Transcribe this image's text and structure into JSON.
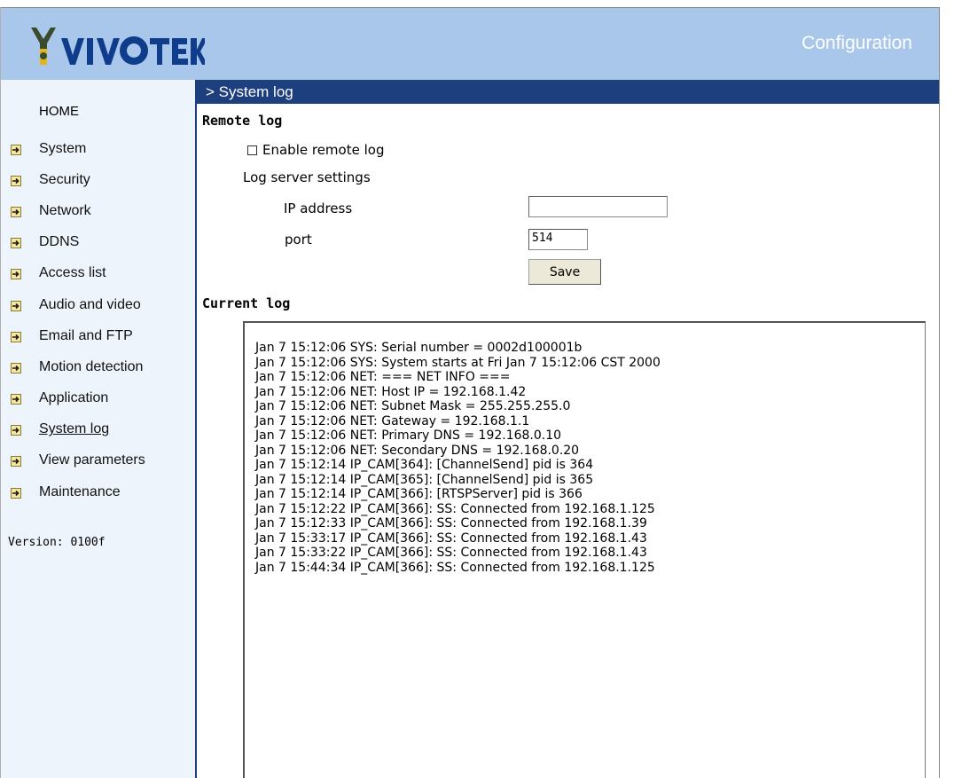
{
  "header": {
    "logo_text": "VIVOTEK",
    "title": "Configuration",
    "background": "#a9c7ea"
  },
  "sidebar": {
    "home_label": "HOME",
    "items": [
      {
        "label": "System",
        "icon": "arrow-right-icon"
      },
      {
        "label": "Security",
        "icon": "arrow-right-icon"
      },
      {
        "label": "Network",
        "icon": "arrow-right-icon"
      },
      {
        "label": "DDNS",
        "icon": "arrow-right-icon"
      },
      {
        "label": "Access list",
        "icon": "arrow-right-icon"
      },
      {
        "label": "Audio and video",
        "icon": "arrow-right-icon"
      },
      {
        "label": "Email and FTP",
        "icon": "arrow-right-icon"
      },
      {
        "label": "Motion detection",
        "icon": "arrow-right-icon"
      },
      {
        "label": "Application",
        "icon": "arrow-right-icon"
      },
      {
        "label": "System log",
        "icon": "arrow-right-icon",
        "active": true
      },
      {
        "label": "View parameters",
        "icon": "arrow-right-icon"
      },
      {
        "label": "Maintenance",
        "icon": "arrow-right-icon"
      }
    ],
    "version": "Version: 0100f"
  },
  "page": {
    "title": "> System log",
    "accent": "#1e3f7d"
  },
  "remote_log": {
    "heading": "Remote log",
    "enable_label": "Enable remote log",
    "enable_checked": false,
    "server_settings_label": "Log server settings",
    "ip_label": "IP address",
    "ip_value": "",
    "port_label": "port",
    "port_value": "514",
    "save_label": "Save"
  },
  "current_log": {
    "heading": "Current log",
    "lines": [
      "Jan 7 15:12:06 SYS: Serial number = 0002d100001b",
      "Jan 7 15:12:06 SYS: System starts at Fri Jan 7 15:12:06 CST 2000",
      "Jan 7 15:12:06 NET: === NET INFO ===",
      "Jan 7 15:12:06 NET: Host IP = 192.168.1.42",
      "Jan 7 15:12:06 NET: Subnet Mask = 255.255.255.0",
      "Jan 7 15:12:06 NET: Gateway = 192.168.1.1",
      "Jan 7 15:12:06 NET: Primary DNS = 192.168.0.10",
      "Jan 7 15:12:06 NET: Secondary DNS = 192.168.0.20",
      "Jan 7 15:12:14 IP_CAM[364]: [ChannelSend] pid is 364",
      "Jan 7 15:12:14 IP_CAM[365]: [ChannelSend] pid is 365",
      "Jan 7 15:12:14 IP_CAM[366]: [RTSPServer] pid is 366",
      "Jan 7 15:12:22 IP_CAM[366]: SS: Connected from 192.168.1.125",
      "Jan 7 15:12:33 IP_CAM[366]: SS: Connected from 192.168.1.39",
      "Jan 7 15:33:17 IP_CAM[366]: SS: Connected from 192.168.1.43",
      "Jan 7 15:33:22 IP_CAM[366]: SS: Connected from 192.168.1.43",
      "Jan 7 15:44:34 IP_CAM[366]: SS: Connected from 192.168.1.125"
    ]
  }
}
